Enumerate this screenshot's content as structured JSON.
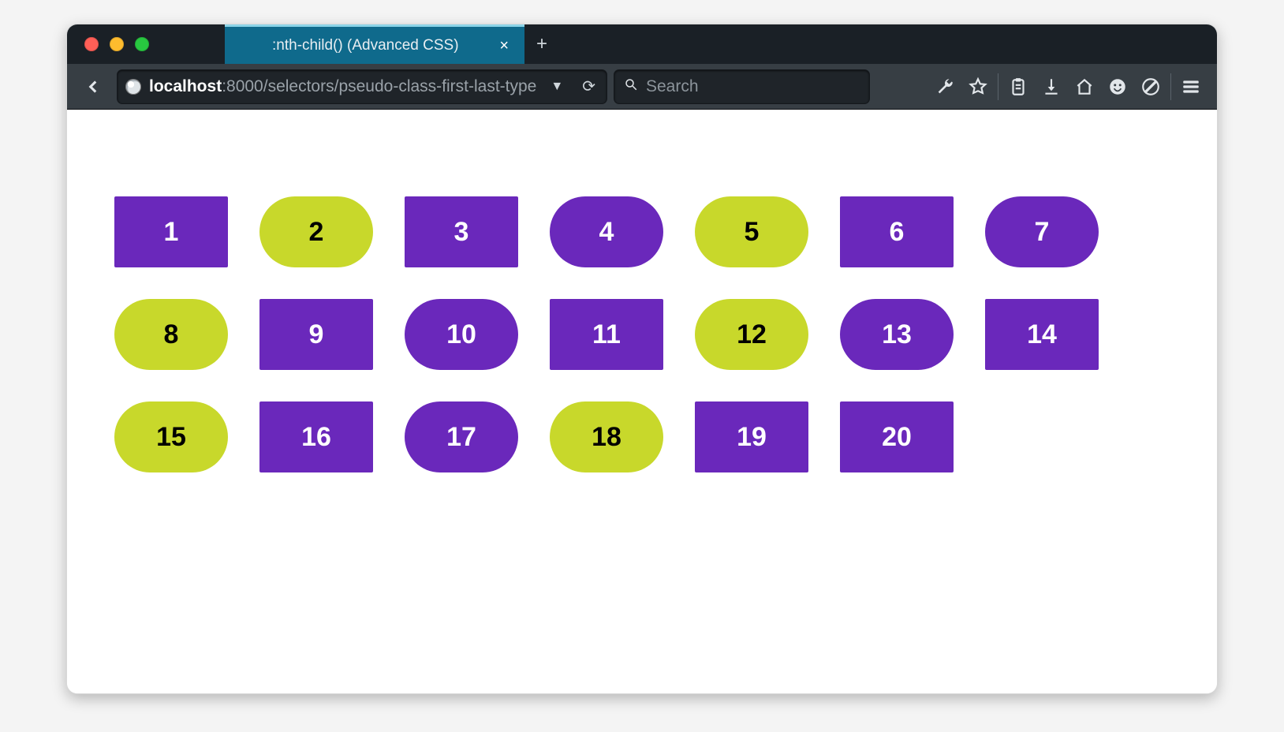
{
  "window": {
    "tab_title": ":nth-child() (Advanced CSS)"
  },
  "toolbar": {
    "url_host": "localhost",
    "url_path": ":8000/selectors/pseudo-class-first-last-type",
    "search_placeholder": "Search"
  },
  "colors": {
    "purple": "#6a28bb",
    "yellow": "#c8d82b"
  },
  "boxes": [
    {
      "n": "1",
      "shape": "rect",
      "color": "purple"
    },
    {
      "n": "2",
      "shape": "pill",
      "color": "yellow"
    },
    {
      "n": "3",
      "shape": "rect",
      "color": "purple"
    },
    {
      "n": "4",
      "shape": "pill",
      "color": "purple"
    },
    {
      "n": "5",
      "shape": "pill",
      "color": "yellow"
    },
    {
      "n": "6",
      "shape": "rect",
      "color": "purple"
    },
    {
      "n": "7",
      "shape": "pill",
      "color": "purple"
    },
    {
      "n": "8",
      "shape": "pill",
      "color": "yellow"
    },
    {
      "n": "9",
      "shape": "rect",
      "color": "purple"
    },
    {
      "n": "10",
      "shape": "pill",
      "color": "purple"
    },
    {
      "n": "11",
      "shape": "rect",
      "color": "purple"
    },
    {
      "n": "12",
      "shape": "pill",
      "color": "yellow"
    },
    {
      "n": "13",
      "shape": "pill",
      "color": "purple"
    },
    {
      "n": "14",
      "shape": "rect",
      "color": "purple"
    },
    {
      "n": "15",
      "shape": "pill",
      "color": "yellow"
    },
    {
      "n": "16",
      "shape": "rect",
      "color": "purple"
    },
    {
      "n": "17",
      "shape": "pill",
      "color": "purple"
    },
    {
      "n": "18",
      "shape": "pill",
      "color": "yellow"
    },
    {
      "n": "19",
      "shape": "rect",
      "color": "purple"
    },
    {
      "n": "20",
      "shape": "rect",
      "color": "purple"
    }
  ]
}
